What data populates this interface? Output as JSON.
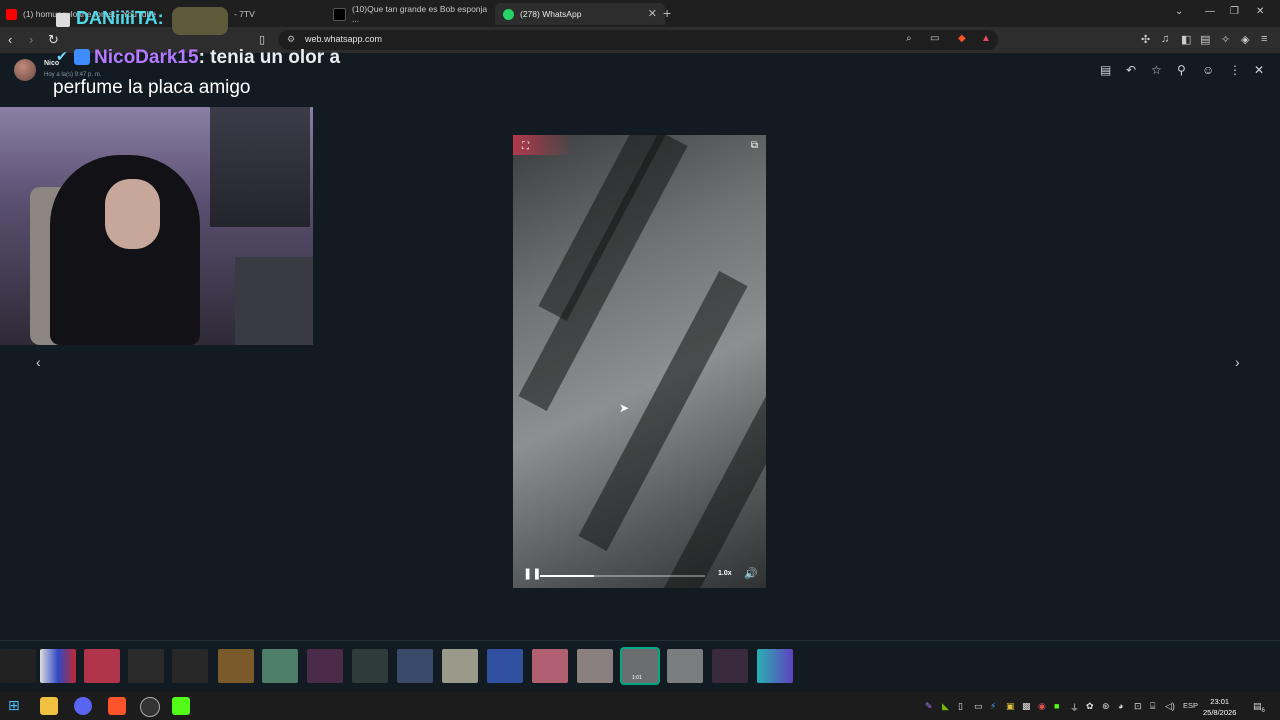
{
  "tabs": [
    {
      "label": "(1) homunculo the forest - YouTube"
    },
    {
      "label": "(10)Que tan grande es Bob esponja ..."
    },
    {
      "label": "(278) WhatsApp"
    }
  ],
  "tab_right_text": "- 7TV",
  "address": {
    "url": "web.whatsapp.com"
  },
  "viewer": {
    "sender": "Nico",
    "timestamp": "Hoy a la(s) 9:47 p. m."
  },
  "overlay": {
    "user1": "DANiiiiTA:",
    "user2": "NicoDark15",
    "msg2a": ": tenia un olor a",
    "msg2b": "perfume la placa amigo"
  },
  "video": {
    "speed": "1.0x",
    "progress": 0.33
  },
  "thumbnail_duration": "1:01",
  "taskbar": {
    "lang": "ESP",
    "time": "23:01",
    "date": "25/8/2026",
    "notif_count": "6"
  },
  "colors": {
    "accent": "#00a884",
    "bg": "#111b21",
    "name_purple": "#b679ff"
  }
}
